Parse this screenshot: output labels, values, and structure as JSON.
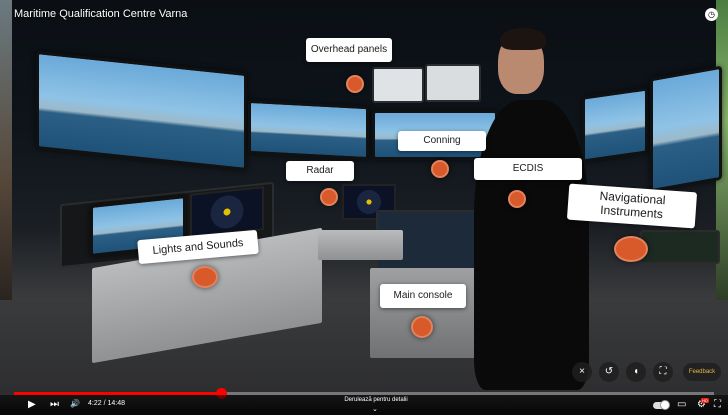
{
  "video": {
    "title": "Maritime Qualification Centre Varna",
    "time": "4:22 / 14:48",
    "progress_fraction": 0.295,
    "scroll_hint": "Derulează pentru detalii",
    "feedback_label": "Feedback"
  },
  "hotspots": {
    "overhead_panels": "Overhead panels",
    "conning": "Conning",
    "radar": "Radar",
    "ecdis": "ECDIS",
    "navigational_instruments": "Navigational Instruments",
    "lights_and_sounds": "Lights and Sounds",
    "main_console": "Main console"
  },
  "icons": {
    "close": "×",
    "rewind": "↺",
    "volume360": "◖",
    "fullscreen360": "⛶",
    "play": "▶",
    "next": "⏭",
    "volume": "🔊",
    "chevron": "⌄",
    "clock": "◷",
    "subtitles": "▭",
    "settings": "⚙",
    "fullscreen": "⛶"
  },
  "colors": {
    "hotspot_dot": "#d8592a",
    "progress": "#ff0000"
  }
}
